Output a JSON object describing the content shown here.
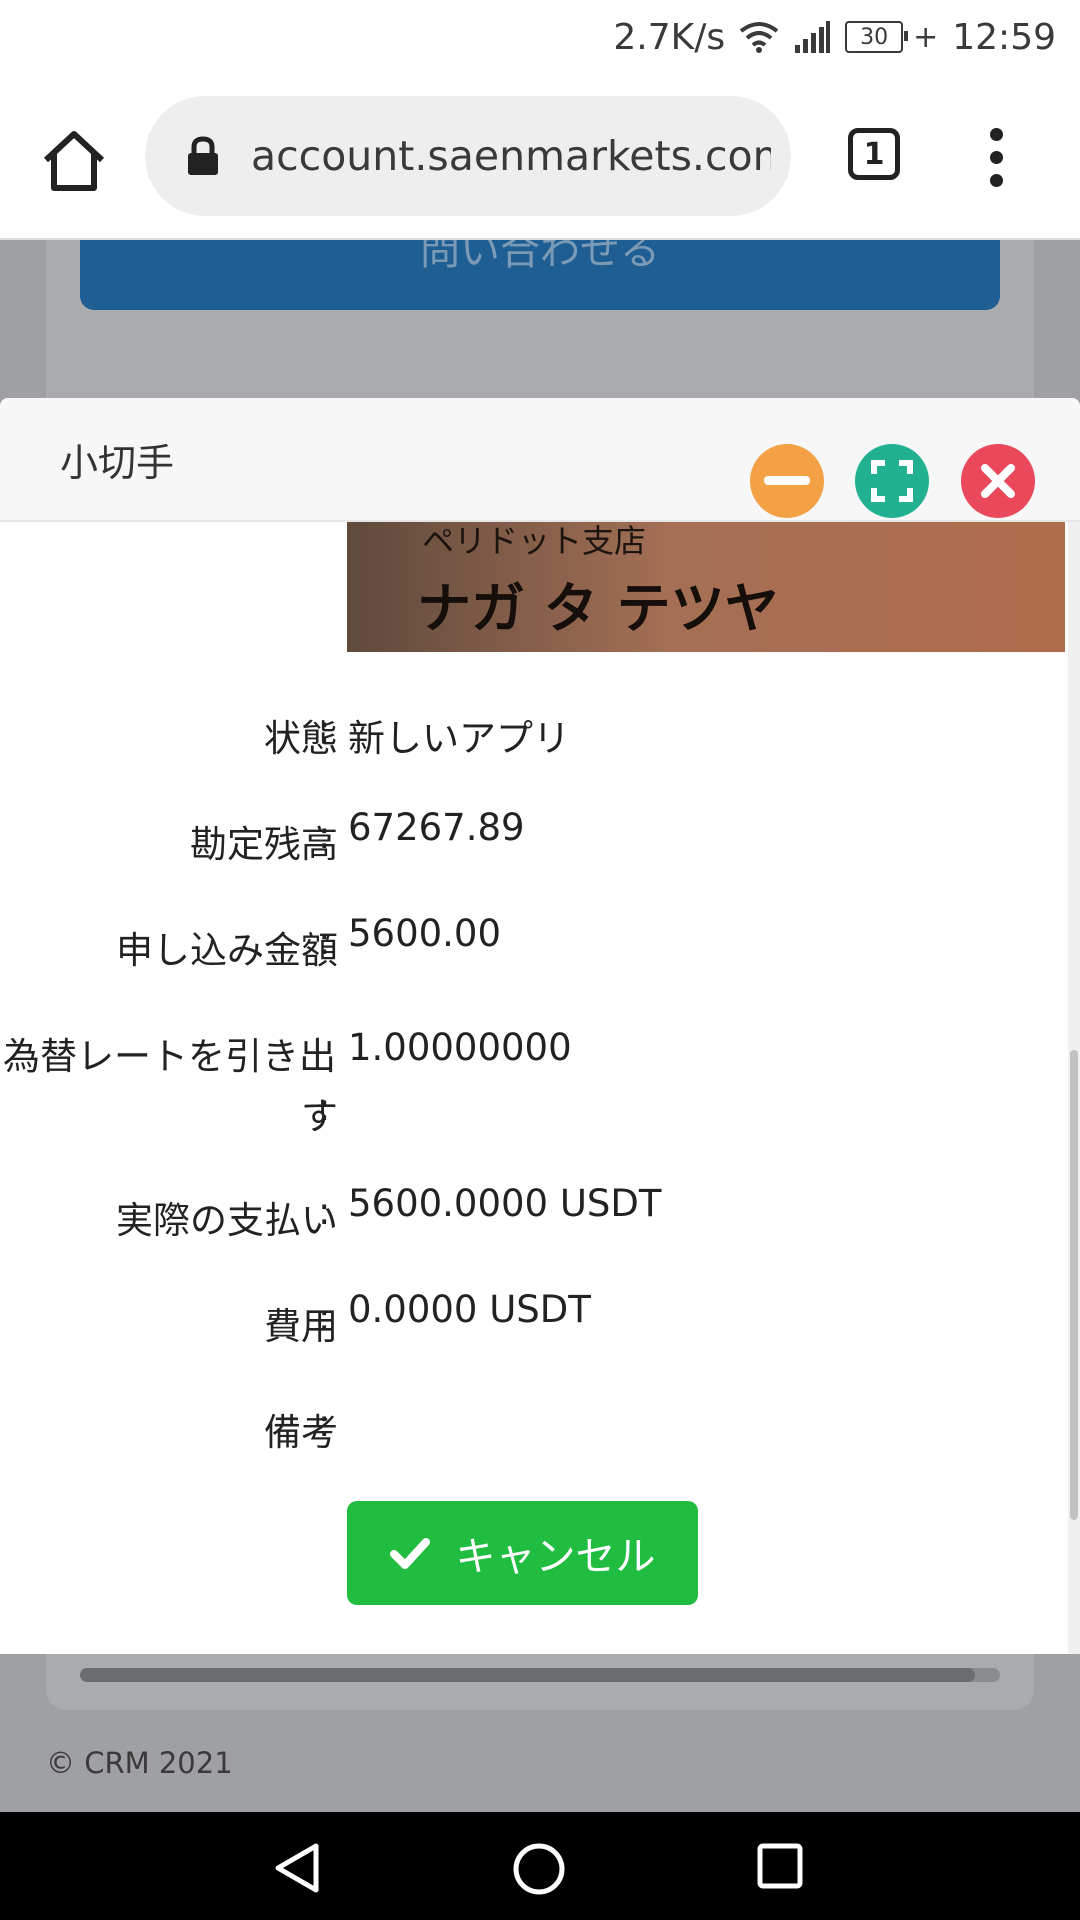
{
  "status_bar": {
    "net_speed": "2.7K/s",
    "battery_level": "30",
    "time": "12:59",
    "icons": [
      "wifi-icon",
      "signal-icon",
      "battery-icon",
      "charging-icon"
    ]
  },
  "browser": {
    "url": "account.saenmarkets.com/v",
    "tab_count": "1",
    "icons": [
      "home-icon",
      "lock-icon",
      "tabs-icon",
      "more-vert-icon"
    ]
  },
  "background_page": {
    "button_label": "問い合わせる",
    "footer": "© CRM 2021",
    "button_color": "#1e5e92"
  },
  "modal": {
    "title": "小切手",
    "photo_text_line1": "ペリドット支店",
    "photo_text_line2": "ナガ タ テツヤ",
    "rows": [
      {
        "label": "状態",
        "colon": ":",
        "value": "新しいアプリ"
      },
      {
        "label": "勘定残高",
        "colon": ":",
        "value": "67267.89"
      },
      {
        "label": "申し込み金額",
        "colon": ":",
        "value": "5600.00"
      },
      {
        "label_line1": "為替レートを引き出",
        "label_line2": "す",
        "colon": ":",
        "value": "1.00000000"
      },
      {
        "label": "実際の支払い",
        "colon": ":",
        "value": "5600.0000 USDT"
      },
      {
        "label": "費用",
        "colon": ":",
        "value": "0.0000 USDT"
      },
      {
        "label": "備考",
        "colon": ":",
        "value": ""
      }
    ],
    "cancel_label": "キャンセル",
    "colors": {
      "minimize": "#f4a145",
      "maximize": "#22b190",
      "close": "#e9495a",
      "cancel": "#20bd40"
    }
  },
  "nav": {
    "icons": [
      "back-icon",
      "home-circle-icon",
      "recents-icon"
    ]
  }
}
